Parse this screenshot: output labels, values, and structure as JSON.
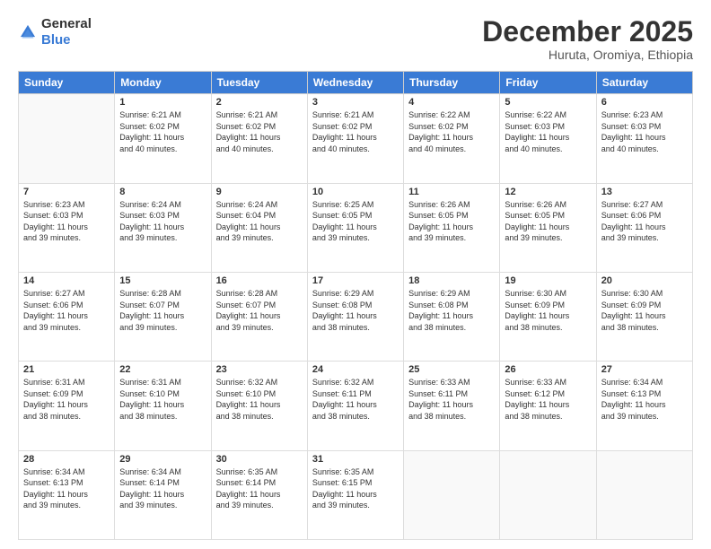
{
  "logo": {
    "general": "General",
    "blue": "Blue"
  },
  "title": "December 2025",
  "subtitle": "Huruta, Oromiya, Ethiopia",
  "days_of_week": [
    "Sunday",
    "Monday",
    "Tuesday",
    "Wednesday",
    "Thursday",
    "Friday",
    "Saturday"
  ],
  "weeks": [
    [
      {
        "day": "",
        "info": ""
      },
      {
        "day": "1",
        "info": "Sunrise: 6:21 AM\nSunset: 6:02 PM\nDaylight: 11 hours\nand 40 minutes."
      },
      {
        "day": "2",
        "info": "Sunrise: 6:21 AM\nSunset: 6:02 PM\nDaylight: 11 hours\nand 40 minutes."
      },
      {
        "day": "3",
        "info": "Sunrise: 6:21 AM\nSunset: 6:02 PM\nDaylight: 11 hours\nand 40 minutes."
      },
      {
        "day": "4",
        "info": "Sunrise: 6:22 AM\nSunset: 6:02 PM\nDaylight: 11 hours\nand 40 minutes."
      },
      {
        "day": "5",
        "info": "Sunrise: 6:22 AM\nSunset: 6:03 PM\nDaylight: 11 hours\nand 40 minutes."
      },
      {
        "day": "6",
        "info": "Sunrise: 6:23 AM\nSunset: 6:03 PM\nDaylight: 11 hours\nand 40 minutes."
      }
    ],
    [
      {
        "day": "7",
        "info": "Sunrise: 6:23 AM\nSunset: 6:03 PM\nDaylight: 11 hours\nand 39 minutes."
      },
      {
        "day": "8",
        "info": "Sunrise: 6:24 AM\nSunset: 6:03 PM\nDaylight: 11 hours\nand 39 minutes."
      },
      {
        "day": "9",
        "info": "Sunrise: 6:24 AM\nSunset: 6:04 PM\nDaylight: 11 hours\nand 39 minutes."
      },
      {
        "day": "10",
        "info": "Sunrise: 6:25 AM\nSunset: 6:05 PM\nDaylight: 11 hours\nand 39 minutes."
      },
      {
        "day": "11",
        "info": "Sunrise: 6:26 AM\nSunset: 6:05 PM\nDaylight: 11 hours\nand 39 minutes."
      },
      {
        "day": "12",
        "info": "Sunrise: 6:26 AM\nSunset: 6:05 PM\nDaylight: 11 hours\nand 39 minutes."
      },
      {
        "day": "13",
        "info": "Sunrise: 6:27 AM\nSunset: 6:06 PM\nDaylight: 11 hours\nand 39 minutes."
      }
    ],
    [
      {
        "day": "14",
        "info": "Sunrise: 6:27 AM\nSunset: 6:06 PM\nDaylight: 11 hours\nand 39 minutes."
      },
      {
        "day": "15",
        "info": "Sunrise: 6:28 AM\nSunset: 6:07 PM\nDaylight: 11 hours\nand 39 minutes."
      },
      {
        "day": "16",
        "info": "Sunrise: 6:28 AM\nSunset: 6:07 PM\nDaylight: 11 hours\nand 39 minutes."
      },
      {
        "day": "17",
        "info": "Sunrise: 6:29 AM\nSunset: 6:08 PM\nDaylight: 11 hours\nand 38 minutes."
      },
      {
        "day": "18",
        "info": "Sunrise: 6:29 AM\nSunset: 6:08 PM\nDaylight: 11 hours\nand 38 minutes."
      },
      {
        "day": "19",
        "info": "Sunrise: 6:30 AM\nSunset: 6:09 PM\nDaylight: 11 hours\nand 38 minutes."
      },
      {
        "day": "20",
        "info": "Sunrise: 6:30 AM\nSunset: 6:09 PM\nDaylight: 11 hours\nand 38 minutes."
      }
    ],
    [
      {
        "day": "21",
        "info": "Sunrise: 6:31 AM\nSunset: 6:09 PM\nDaylight: 11 hours\nand 38 minutes."
      },
      {
        "day": "22",
        "info": "Sunrise: 6:31 AM\nSunset: 6:10 PM\nDaylight: 11 hours\nand 38 minutes."
      },
      {
        "day": "23",
        "info": "Sunrise: 6:32 AM\nSunset: 6:10 PM\nDaylight: 11 hours\nand 38 minutes."
      },
      {
        "day": "24",
        "info": "Sunrise: 6:32 AM\nSunset: 6:11 PM\nDaylight: 11 hours\nand 38 minutes."
      },
      {
        "day": "25",
        "info": "Sunrise: 6:33 AM\nSunset: 6:11 PM\nDaylight: 11 hours\nand 38 minutes."
      },
      {
        "day": "26",
        "info": "Sunrise: 6:33 AM\nSunset: 6:12 PM\nDaylight: 11 hours\nand 38 minutes."
      },
      {
        "day": "27",
        "info": "Sunrise: 6:34 AM\nSunset: 6:13 PM\nDaylight: 11 hours\nand 39 minutes."
      }
    ],
    [
      {
        "day": "28",
        "info": "Sunrise: 6:34 AM\nSunset: 6:13 PM\nDaylight: 11 hours\nand 39 minutes."
      },
      {
        "day": "29",
        "info": "Sunrise: 6:34 AM\nSunset: 6:14 PM\nDaylight: 11 hours\nand 39 minutes."
      },
      {
        "day": "30",
        "info": "Sunrise: 6:35 AM\nSunset: 6:14 PM\nDaylight: 11 hours\nand 39 minutes."
      },
      {
        "day": "31",
        "info": "Sunrise: 6:35 AM\nSunset: 6:15 PM\nDaylight: 11 hours\nand 39 minutes."
      },
      {
        "day": "",
        "info": ""
      },
      {
        "day": "",
        "info": ""
      },
      {
        "day": "",
        "info": ""
      }
    ]
  ]
}
